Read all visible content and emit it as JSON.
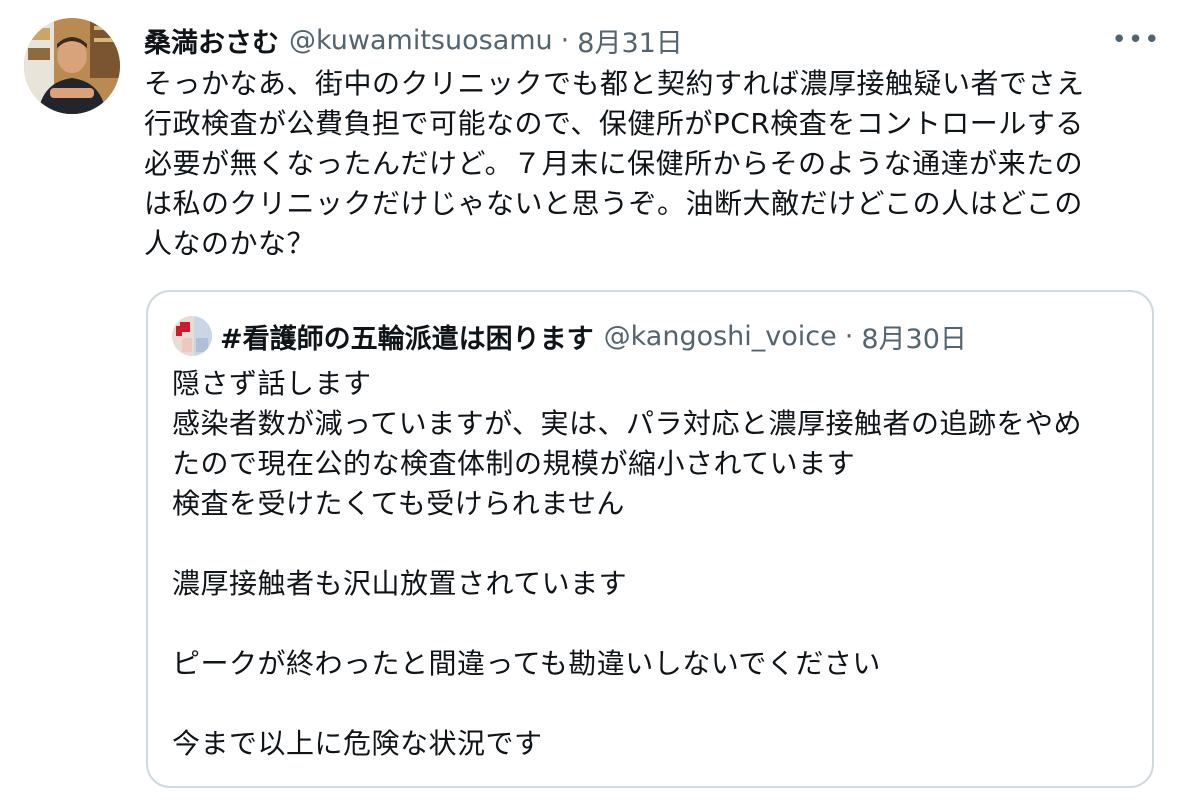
{
  "tweet": {
    "author_name": "桑満おさむ",
    "handle": "@kuwamitsuosamu",
    "separator": "·",
    "date": "8月31日",
    "more_icon": "more-horizontal-icon",
    "more_glyph": "•••",
    "text": "そっかなあ、街中のクリニックでも都と契約すれば濃厚接触疑い者でさえ\n行政検査が公費負担で可能なので、保健所がPCR検査をコントロールする\n必要が無くなったんだけど。７月末に保健所からそのような通達が来たの\nは私のクリニックだけじゃないと思うぞ。油断大敵だけどこの人はどこの\n人なのかな？"
  },
  "quoted_tweet": {
    "author_name": "#看護師の五輪派遣は困ります",
    "handle": "@kangoshi_voice",
    "separator": "·",
    "date": "8月30日",
    "text": "隠さず話します\n感染者数が減っていますが、実は、パラ対応と濃厚接触者の追跡をやめ\nたので現在公的な検査体制の規模が縮小されています\n検査を受けたくても受けられません\n\n濃厚接触者も沢山放置されています\n\nピークが終わったと間違っても勘違いしないでください\n\n今まで以上に危険な状況です"
  },
  "colors": {
    "text_primary": "#0f1419",
    "text_secondary": "#536471",
    "border": "#cfd9de",
    "background": "#ffffff"
  }
}
